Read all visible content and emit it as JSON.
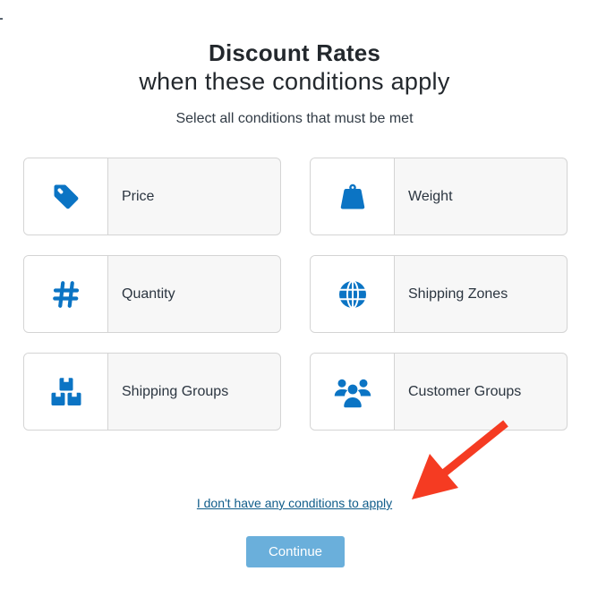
{
  "header": {
    "title": "Discount Rates",
    "subtitle_line": "when these conditions apply",
    "instruction": "Select all conditions that must be met"
  },
  "conditions": [
    {
      "label": "Price",
      "icon": "price-tag-icon"
    },
    {
      "label": "Weight",
      "icon": "weight-icon"
    },
    {
      "label": "Quantity",
      "icon": "hash-icon"
    },
    {
      "label": "Shipping Zones",
      "icon": "globe-icon"
    },
    {
      "label": "Shipping Groups",
      "icon": "boxes-icon"
    },
    {
      "label": "Customer Groups",
      "icon": "users-icon"
    }
  ],
  "footer": {
    "no_conditions_link": "I don't have any conditions to apply",
    "continue_label": "Continue"
  },
  "colors": {
    "icon_blue": "#0b74c4",
    "button_blue": "#6aafdb",
    "link_blue": "#0f5c8a",
    "annotation_arrow": "#f53b22"
  }
}
